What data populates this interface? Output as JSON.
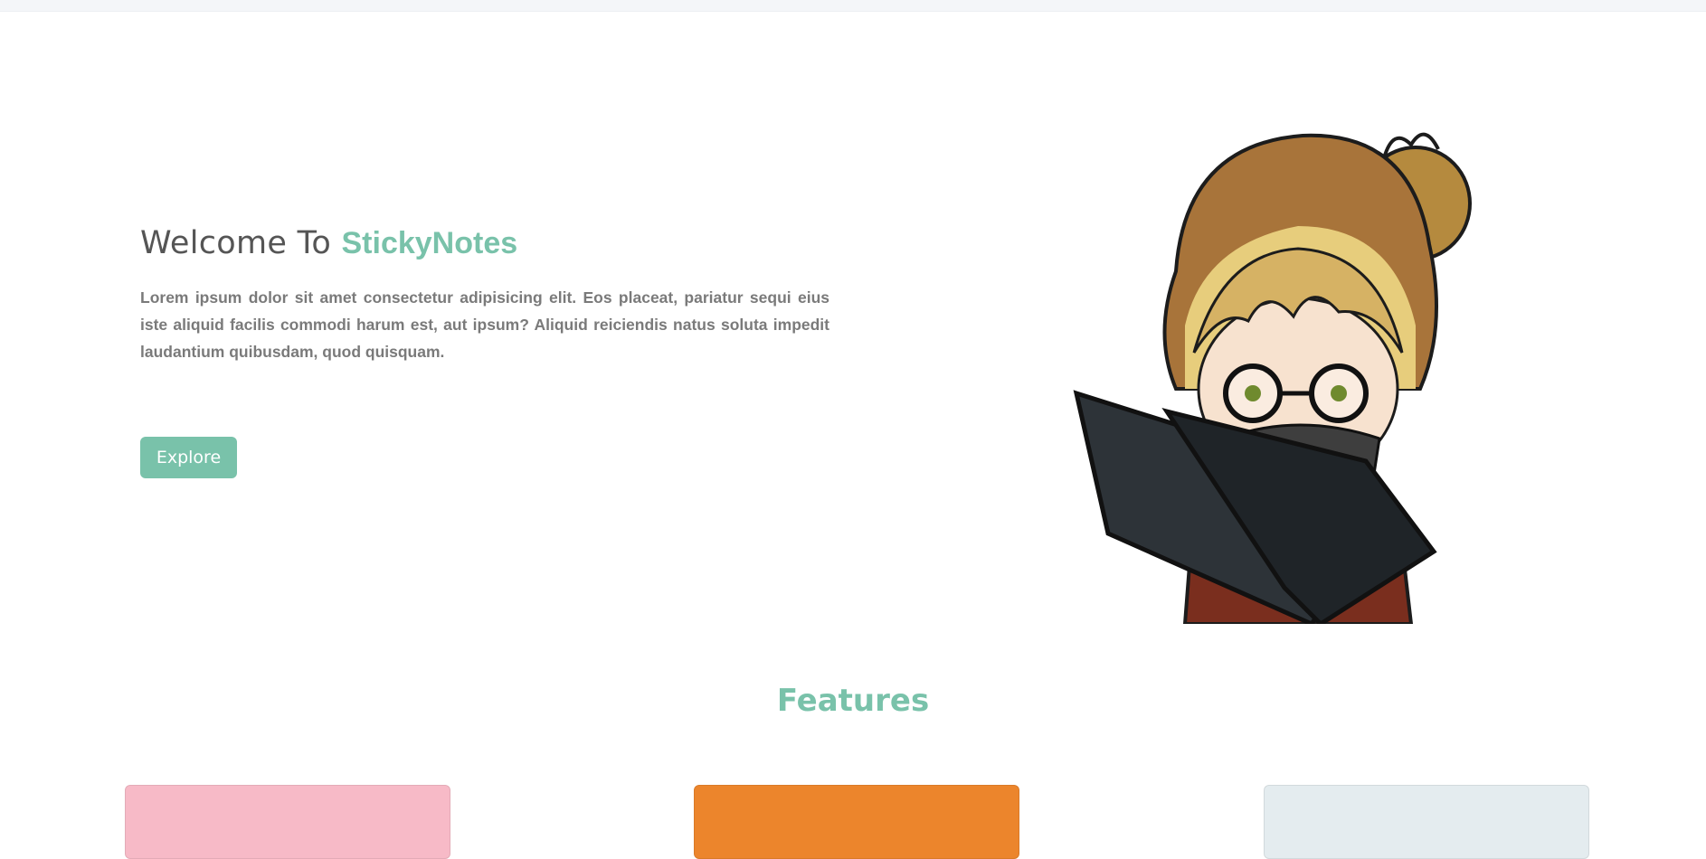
{
  "hero": {
    "title_prefix": "Welcome To ",
    "brand_name": "StickyNotes",
    "description": "Lorem ipsum dolor sit amet consectetur adipisicing elit. Eos placeat, pariatur sequi eius iste aliquid facilis commodi harum est, aut ipsum? Aliquid reiciendis natus soluta impedit laudantium quibusdam, quod quisquam.",
    "explore_label": "Explore",
    "illustration_icon": "girl-with-laptop-illustration"
  },
  "features": {
    "title": "Features",
    "cards": [
      {
        "color": "#f7bac7"
      },
      {
        "color": "#ec852c"
      },
      {
        "color": "#e4ecef"
      }
    ]
  },
  "colors": {
    "accent": "#79c2aa",
    "text": "#555555",
    "muted_text": "#7a7a7a"
  }
}
